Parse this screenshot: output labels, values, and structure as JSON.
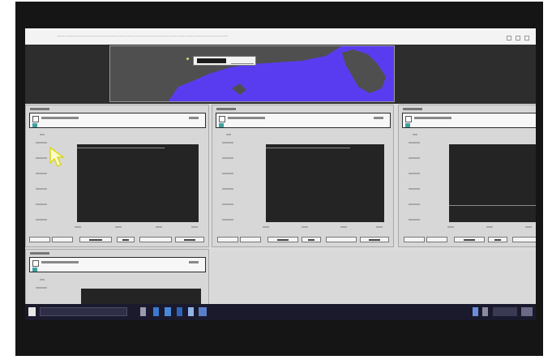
{
  "colors": {
    "photo_frame": "#ffffff",
    "monitor_bezel": "#151515",
    "desktop_background": "#dcdcdc",
    "map_water": "#5a3cf0",
    "map_land": "#4f4f4f",
    "plot_background": "#242424",
    "trace": "#8a8a8a",
    "status_indicator": "#3ea1a1",
    "taskbar": "#1a1a2c"
  },
  "window": {
    "title_buttons": [
      "minimize-icon",
      "maximize-icon",
      "close-icon"
    ]
  },
  "map": {
    "legend_swatch": "black-swatch",
    "marker_icon": "location-marker-icon"
  },
  "monitor_panels": [
    {
      "id": "panel-1",
      "status_icon": "status-indicator-icon",
      "trace_level": 0.96,
      "axis_ticks_y": 6,
      "axis_ticks_x": 4,
      "buttons": 6
    },
    {
      "id": "panel-2",
      "status_icon": "status-indicator-icon",
      "trace_level": 0.96,
      "axis_ticks_y": 6,
      "axis_ticks_x": 4,
      "buttons": 6
    },
    {
      "id": "panel-3",
      "status_icon": "status-indicator-icon",
      "trace_level": 0.22,
      "axis_ticks_y": 6,
      "axis_ticks_x": 4,
      "buttons": 5
    },
    {
      "id": "panel-4",
      "status_icon": "status-indicator-icon",
      "axis_ticks_y": 1
    }
  ],
  "taskbar": {
    "left_icons": [
      "start-icon",
      "search-icon",
      "task-view-icon"
    ],
    "pinned_icons": [
      "file-explorer-icon",
      "browser-icon",
      "mail-icon",
      "store-icon",
      "app-icon"
    ],
    "tray_icons": [
      "network-icon",
      "volume-icon",
      "clock-icon",
      "notification-icon"
    ]
  },
  "cursor_icon": "mouse-pointer-icon"
}
